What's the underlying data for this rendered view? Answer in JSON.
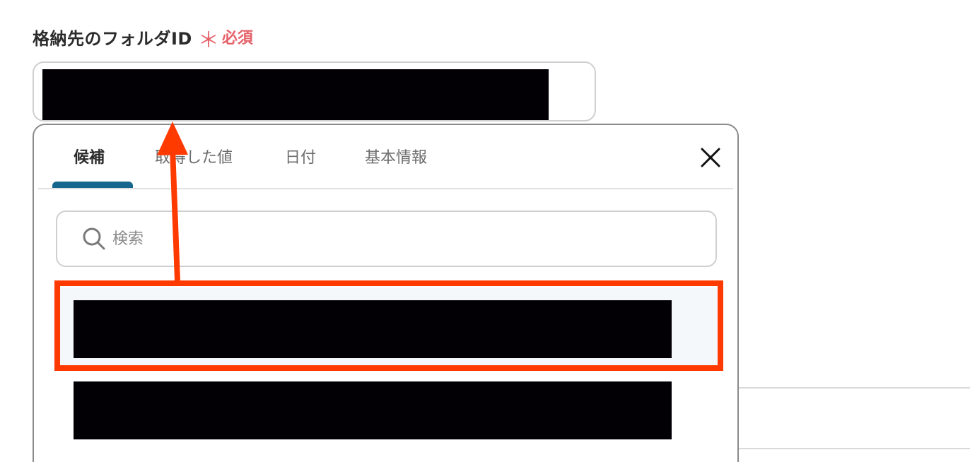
{
  "field": {
    "label": "格納先のフォルダID",
    "required_mark": "＊",
    "required_text": "必須"
  },
  "panel": {
    "tabs": [
      {
        "label": "候補",
        "active": true
      },
      {
        "label": "取得した値",
        "active": false
      },
      {
        "label": "日付",
        "active": false
      },
      {
        "label": "基本情報",
        "active": false
      }
    ],
    "search": {
      "placeholder": "検索"
    }
  },
  "colors": {
    "required_red": "#e5626a",
    "tab_active_underline": "#16668d",
    "annotation_orange": "#ff3a00",
    "redaction": "#020005"
  },
  "icons": [
    "search-icon",
    "close-icon"
  ]
}
